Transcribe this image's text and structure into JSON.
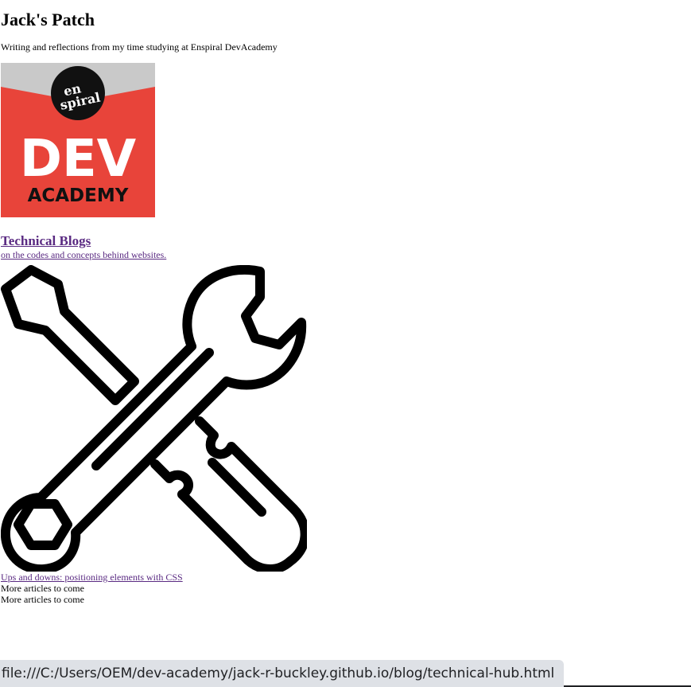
{
  "header": {
    "title": "Jack's Patch",
    "subtitle": "Writing and reflections from my time studying at Enspiral DevAcademy"
  },
  "logo": {
    "line1": "en",
    "line2": "spiral",
    "line3": "DEV",
    "line4": "ACADEMY",
    "colors": {
      "top": "#c9c9c9",
      "bottom": "#e8443a",
      "circle": "#111111",
      "text": "#ffffff"
    }
  },
  "section": {
    "heading": "Technical Blogs",
    "tagline": "on the codes and concepts behind websites.",
    "icon": "wrench-screwdriver-icon"
  },
  "articles": {
    "first": "Ups and downs: positioning elements with CSS",
    "more1": "More articles to come",
    "more2": "More articles to come"
  },
  "status": {
    "url": "file:///C:/Users/OEM/dev-academy/jack-r-buckley.github.io/blog/technical-hub.html"
  }
}
